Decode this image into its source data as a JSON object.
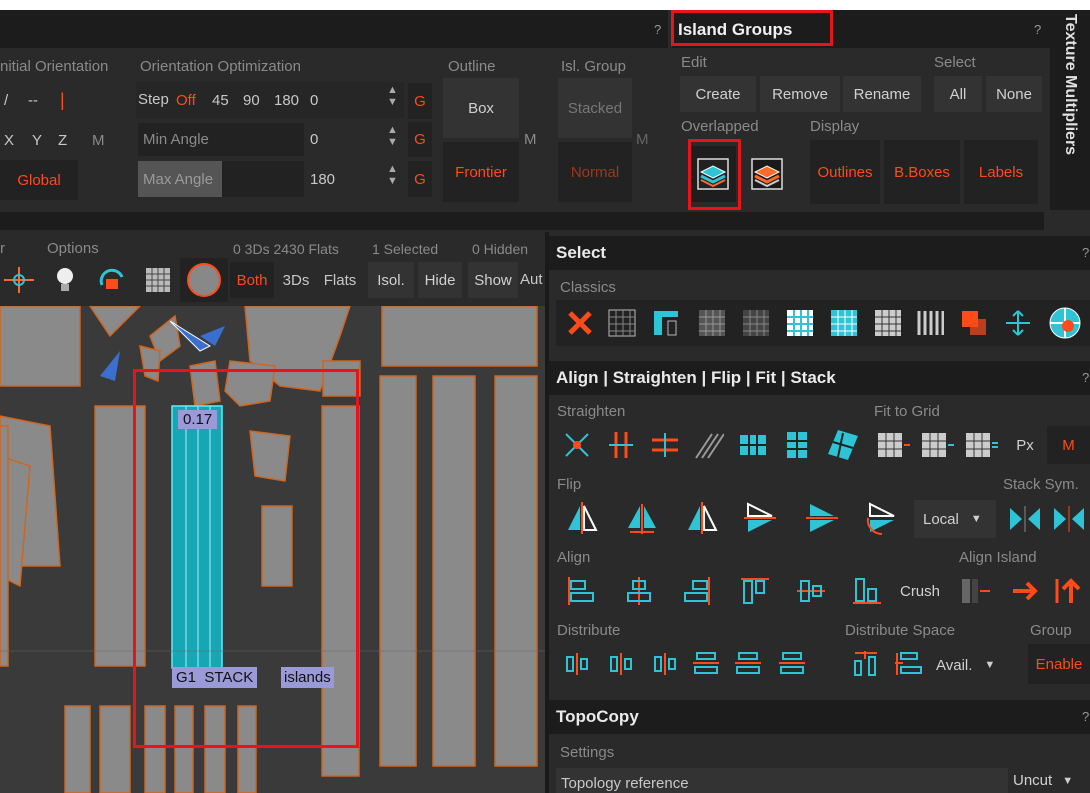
{
  "colors": {
    "accent": "#ff4a1a",
    "cyan": "#2ec4d6",
    "panel": "#2a2a2a",
    "dark": "#1c1c1c"
  },
  "top_left": {
    "question": "?",
    "init_orient": {
      "title": "nitial Orientation",
      "r1a": "/",
      "r1b": "--",
      "r1c": "|",
      "x": "X",
      "y": "Y",
      "z": "Z",
      "m": "M",
      "global": "Global"
    },
    "orient_opt": {
      "title": "Orientation Optimization",
      "step": "Step",
      "off": "Off",
      "v45": "45",
      "v90": "90",
      "v180": "180",
      "v0": "0",
      "g": "G",
      "min_angle": "Min Angle",
      "min_val": "0",
      "max_angle": "Max Angle",
      "max_val": "180"
    },
    "outline": {
      "title": "Outline",
      "box": "Box",
      "m": "M",
      "frontier": "Frontier"
    },
    "isl_group": {
      "title": "Isl. Group",
      "stacked": "Stacked",
      "m": "M",
      "normal": "Normal"
    }
  },
  "island_groups": {
    "title": "Island Groups",
    "question": "?",
    "edit": "Edit",
    "create": "Create",
    "remove": "Remove",
    "rename": "Rename",
    "select": "Select",
    "all": "All",
    "none": "None",
    "overlapped": "Overlapped",
    "display": "Display",
    "outlines": "Outlines",
    "bboxes": "B.Boxes",
    "labels": "Labels",
    "side_tab": "Texture Multipliers"
  },
  "viewport_bar": {
    "r": "r",
    "options": "Options",
    "stats": "0 3Ds 2430 Flats",
    "selected": "1 Selected",
    "hidden": "0 Hidden",
    "both": "Both",
    "threeds": "3Ds",
    "flats": "Flats",
    "isol": "Isol.",
    "hide": "Hide",
    "show": "Show",
    "aut": "Aut"
  },
  "viewport": {
    "label_top": "0.17",
    "label_g1": "G1  STACK",
    "label_islands": "islands"
  },
  "select_panel": {
    "title": "Select",
    "question": "?",
    "classics": "Classics"
  },
  "align_panel": {
    "title": "Align | Straighten | Flip | Fit | Stack",
    "question": "?",
    "straighten": "Straighten",
    "fit_to_grid": "Fit to Grid",
    "px": "Px",
    "m": "M",
    "flip": "Flip",
    "stack_sym": "Stack Sym.",
    "local": "Local",
    "align": "Align",
    "align_island": "Align Island",
    "crush": "Crush",
    "distribute": "Distribute",
    "distribute_space": "Distribute Space",
    "group": "Group",
    "avail": "Avail.",
    "enable": "Enable"
  },
  "topocopy": {
    "title": "TopoCopy",
    "question": "?",
    "settings": "Settings",
    "topology_reference": "Topology reference",
    "uncut": "Uncut"
  }
}
